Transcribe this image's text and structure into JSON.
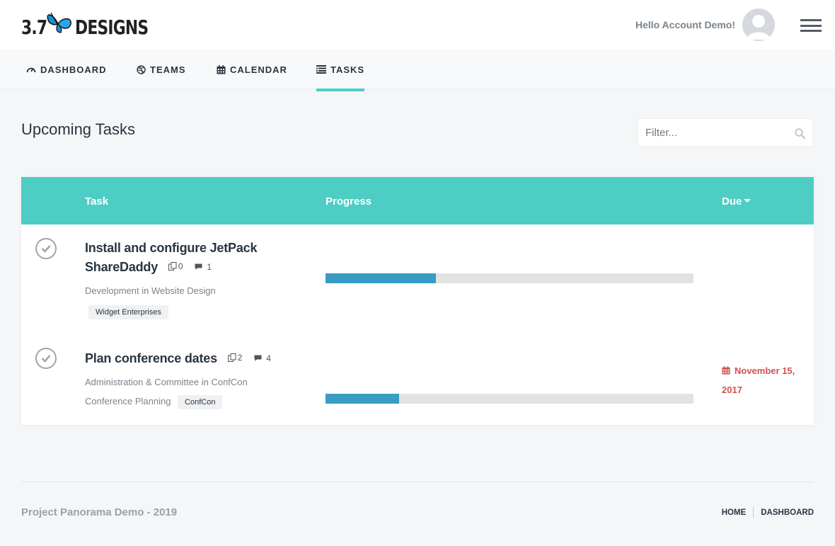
{
  "brand": {
    "logo_number": "3.7",
    "logo_word": "DESIGNS",
    "icon": "butterfly-icon",
    "accent_color": "#4ecdc4"
  },
  "header": {
    "greeting": "Hello Account Demo!",
    "avatar_icon": "user-avatar-icon",
    "menu_icon": "hamburger-menu-icon"
  },
  "nav": {
    "items": [
      {
        "label": "DASHBOARD",
        "icon": "gauge-icon",
        "active": false
      },
      {
        "label": "TEAMS",
        "icon": "dribbble-icon",
        "active": false
      },
      {
        "label": "CALENDAR",
        "icon": "calendar-icon",
        "active": false
      },
      {
        "label": "TASKS",
        "icon": "list-icon",
        "active": true
      }
    ]
  },
  "page": {
    "title": "Upcoming Tasks",
    "filter_placeholder": "Filter...",
    "filter_value": ""
  },
  "table": {
    "columns": {
      "task": "Task",
      "progress": "Progress",
      "due": "Due"
    },
    "rows": [
      {
        "title_line1": "Install and configure JetPack",
        "title_line2": "ShareDaddy",
        "documents": "0",
        "comments": "1",
        "phase": "Development in Website Design",
        "tag": "Widget Enterprises",
        "progress": 30,
        "due": ""
      },
      {
        "title_line1": "Plan conference dates",
        "documents": "2",
        "comments": "4",
        "phase_line1": "Administration & Committee in ConfCon",
        "phase_line2": "Conference Planning",
        "tag": "ConfCon",
        "progress": 20,
        "due_line1": "November 15,",
        "due_line2": "2017",
        "due_color": "#d0524f"
      }
    ]
  },
  "footer": {
    "text": "Project Panorama Demo - 2019",
    "links": [
      "HOME",
      "DASHBOARD"
    ]
  }
}
